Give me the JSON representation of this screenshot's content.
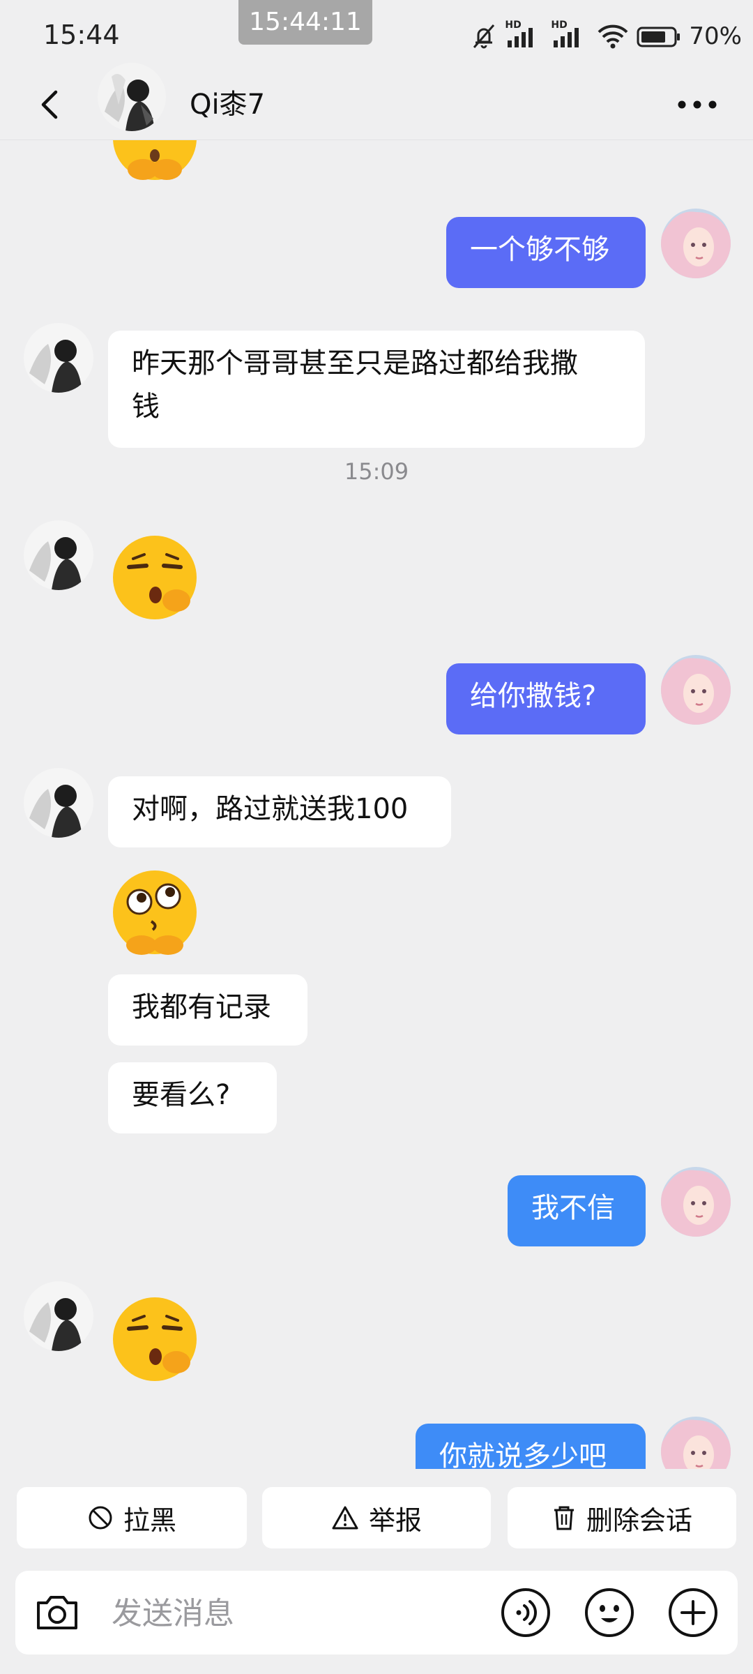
{
  "status_bar": {
    "time": "15:44",
    "screenshot_time": "15:44:11",
    "signal_label_1": "HD",
    "signal_label_2": "HD",
    "battery_percent": "70%"
  },
  "header": {
    "contact_name": "Qi桼7",
    "back_icon": "chevron-left-icon",
    "more_icon": "more-dots-icon"
  },
  "messages": {
    "m1": "一个够不够",
    "m2": "昨天那个哥哥甚至只是路过都给我撒\n钱",
    "time_sep": "15:09",
    "m3": "给你撒钱?",
    "m4": "对啊，路过就送我100",
    "m5": "我都有记录",
    "m6": "要看么?",
    "m7": "我不信",
    "m8": "你就说多少吧"
  },
  "emojis": {
    "e0": "hands-together-emoji",
    "e1": "shushing-face-emoji",
    "e2": "eyes-hands-emoji",
    "e3": "shushing-face-emoji"
  },
  "actions": {
    "block_label": "拉黑",
    "report_label": "举报",
    "delete_label": "删除会话"
  },
  "input": {
    "placeholder": "发送消息"
  },
  "colors": {
    "outgoing_bubble": "#5b6cf6",
    "outgoing_bubble_alt": "#3e8cf7",
    "incoming_bubble": "#ffffff",
    "background": "#efeff0"
  }
}
